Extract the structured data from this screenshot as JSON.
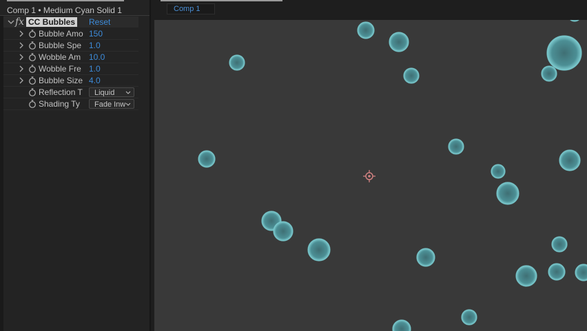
{
  "effect_panel": {
    "title": "Comp 1 • Medium Cyan Solid 1",
    "effect_name": "CC Bubbles",
    "reset_label": "Reset",
    "properties": [
      {
        "label": "Bubble Amo",
        "value": "150",
        "type": "numeric"
      },
      {
        "label": "Bubble Spe",
        "value": "1.0",
        "type": "numeric"
      },
      {
        "label": "Wobble Am",
        "value": "10.0",
        "type": "numeric"
      },
      {
        "label": "Wobble Fre",
        "value": "1.0",
        "type": "numeric"
      },
      {
        "label": "Bubble Size",
        "value": "4.0",
        "type": "numeric"
      },
      {
        "label": "Reflection T",
        "value": "Liquid",
        "type": "dropdown"
      },
      {
        "label": "Shading Ty",
        "value": "Fade Inw",
        "type": "dropdown"
      }
    ]
  },
  "composition": {
    "tab_label": "Comp 1"
  },
  "colors": {
    "accent": "#3d8bd9",
    "bubble_fill": "#4c8f95",
    "bubble_edge": "#78c8cc",
    "viewer_bg": "#393939",
    "anchor_marker": "#d08080"
  }
}
